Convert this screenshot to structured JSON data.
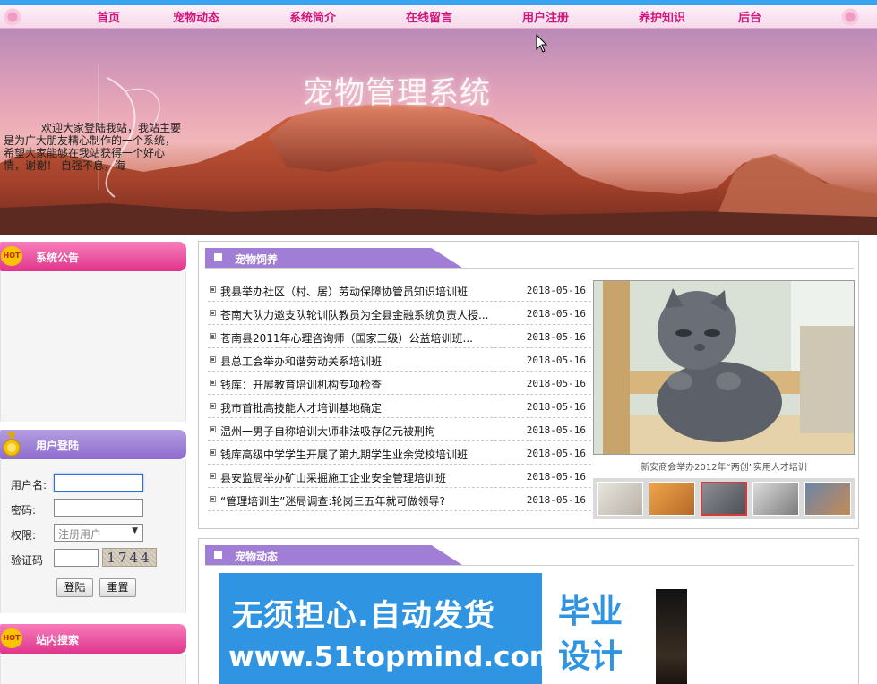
{
  "nav": {
    "items": [
      "首页",
      "宠物动态",
      "系统简介",
      "在线留言",
      "用户注册",
      "养护知识",
      "后台"
    ]
  },
  "banner": {
    "title": "宠物管理系统"
  },
  "notice": {
    "header": "系统公告",
    "hot_badge": "HOT",
    "text": "欢迎大家登陆我站，我站主要是为广大朋友精心制作的一个系统，希望大家能够在我站获得一个好心情，谢谢！ 自强不息，海"
  },
  "login": {
    "header": "用户登陆",
    "username_label": "用户名:",
    "password_label": "密码:",
    "role_label": "权限:",
    "role_value": "注册用户",
    "captcha_label": "验证码",
    "captcha_value": "1744",
    "login_button": "登陆",
    "reset_button": "重置"
  },
  "search": {
    "header": "站内搜索",
    "hot_badge": "HOT"
  },
  "pet_care": {
    "header": "宠物饲养",
    "news": [
      {
        "title": "我县举办社区（村、居）劳动保障协管员知识培训班",
        "date": "2018-05-16"
      },
      {
        "title": "苍南大队力邀支队轮训队教员为全县金融系统负责人授...",
        "date": "2018-05-16"
      },
      {
        "title": "苍南县2011年心理咨询师（国家三级）公益培训班...",
        "date": "2018-05-16"
      },
      {
        "title": "县总工会举办和谐劳动关系培训班",
        "date": "2018-05-16"
      },
      {
        "title": "钱库：开展教育培训机构专项检查",
        "date": "2018-05-16"
      },
      {
        "title": "我市首批高技能人才培训基地确定",
        "date": "2018-05-16"
      },
      {
        "title": "温州一男子自称培训大师非法吸存亿元被刑拘",
        "date": "2018-05-16"
      },
      {
        "title": "钱库高级中学学生开展了第九期学生业余党校培训班",
        "date": "2018-05-16"
      },
      {
        "title": "县安监局举办矿山采掘施工企业安全管理培训班",
        "date": "2018-05-16"
      },
      {
        "title": "“管理培训生”迷局调查:轮岗三五年就可做领导?",
        "date": "2018-05-16"
      }
    ],
    "photo_caption": "新安商会举办2012年“两创”实用人才培训"
  },
  "pet_news": {
    "header": "宠物动态"
  },
  "ad": {
    "line1": "无须担心.自动发货",
    "line2": "www.51topmind.com",
    "badge_top": "毕业",
    "badge_bottom": "设计"
  },
  "colors": {
    "nav_text": "#d4147a",
    "notice_header": "#e0358c",
    "login_header": "#8e6ccf",
    "section_header": "#a07ed6",
    "ad_blue": "#2f95e3"
  }
}
